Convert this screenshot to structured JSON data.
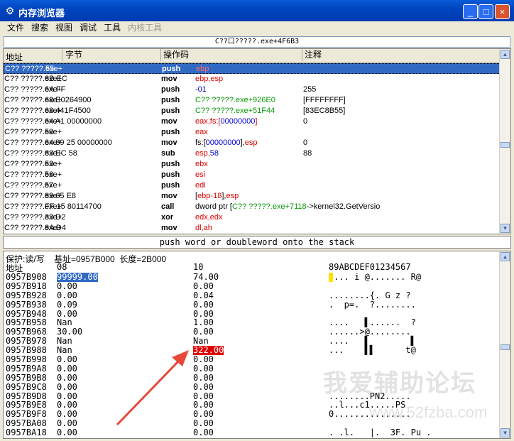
{
  "window": {
    "title": "内存浏览器",
    "buttons": [
      "_",
      "□",
      "×"
    ]
  },
  "menu": [
    {
      "label": "文件",
      "enabled": true
    },
    {
      "label": "搜索",
      "enabled": true
    },
    {
      "label": "视图",
      "enabled": true
    },
    {
      "label": "调试",
      "enabled": true
    },
    {
      "label": "工具",
      "enabled": true
    },
    {
      "label": "内核工具",
      "enabled": false
    }
  ],
  "address_bar": "C??口?????.exe+4F6B3",
  "disasm": {
    "headers": [
      "地址",
      "字节",
      "操作码",
      "注释"
    ],
    "rows": [
      {
        "addr": "C?? ?????.exe+",
        "bytes": "55",
        "op": "push",
        "args": [
          {
            "t": "ebp",
            "c": "red"
          }
        ],
        "comment": "",
        "selected": true
      },
      {
        "addr": "C?? ?????.exe+",
        "bytes": "8B EC",
        "op": "mov",
        "args": [
          {
            "t": "ebp,esp",
            "c": "red"
          }
        ],
        "comment": ""
      },
      {
        "addr": "C?? ?????.exe+",
        "bytes": "6A FF",
        "op": "push",
        "args": [
          {
            "t": "-01",
            "c": "blue"
          }
        ],
        "comment": "255"
      },
      {
        "addr": "C?? ?????.exe+",
        "bytes": "68 E0264900",
        "op": "push",
        "args": [
          {
            "t": "C?? ?????.exe+926E0",
            "c": "green"
          }
        ],
        "comment": "[FFFFFFFF]"
      },
      {
        "addr": "C?? ?????.exe+",
        "bytes": "68 441F4500",
        "op": "push",
        "args": [
          {
            "t": "C?? ?????.exe+51F44",
            "c": "green"
          }
        ],
        "comment": "[83EC8B55]"
      },
      {
        "addr": "C?? ?????.exe+",
        "bytes": "64 A1 00000000",
        "op": "mov",
        "args": [
          {
            "t": "eax,fs:[",
            "c": "red"
          },
          {
            "t": "00000000",
            "c": "blue"
          },
          {
            "t": "]",
            "c": "red"
          }
        ],
        "comment": "0"
      },
      {
        "addr": "C?? ?????.exe+",
        "bytes": "50",
        "op": "push",
        "args": [
          {
            "t": "eax",
            "c": "red"
          }
        ],
        "comment": ""
      },
      {
        "addr": "C?? ?????.exe+",
        "bytes": "64 89 25 00000000",
        "op": "mov",
        "args": [
          {
            "t": "fs:[",
            "c": "black"
          },
          {
            "t": "00000000",
            "c": "blue"
          },
          {
            "t": "],",
            "c": "black"
          },
          {
            "t": "esp",
            "c": "red"
          }
        ],
        "comment": "0"
      },
      {
        "addr": "C?? ?????.exe+",
        "bytes": "83 EC 58",
        "op": "sub",
        "args": [
          {
            "t": "esp,",
            "c": "red"
          },
          {
            "t": "58",
            "c": "blue"
          }
        ],
        "comment": "88"
      },
      {
        "addr": "C?? ?????.exe+",
        "bytes": "53",
        "op": "push",
        "args": [
          {
            "t": "ebx",
            "c": "red"
          }
        ],
        "comment": ""
      },
      {
        "addr": "C?? ?????.exe+",
        "bytes": "56",
        "op": "push",
        "args": [
          {
            "t": "esi",
            "c": "red"
          }
        ],
        "comment": ""
      },
      {
        "addr": "C?? ?????.exe+",
        "bytes": "57",
        "op": "push",
        "args": [
          {
            "t": "edi",
            "c": "red"
          }
        ],
        "comment": ""
      },
      {
        "addr": "C?? ?????.exe+",
        "bytes": "89 65 E8",
        "op": "mov",
        "args": [
          {
            "t": "[",
            "c": "black"
          },
          {
            "t": "ebp-18",
            "c": "red"
          },
          {
            "t": "],",
            "c": "black"
          },
          {
            "t": "esp",
            "c": "red"
          }
        ],
        "comment": ""
      },
      {
        "addr": "C?? ?????.exe+",
        "bytes": "FF 15 80114700",
        "op": "call",
        "args": [
          {
            "t": "dword ptr [",
            "c": "black"
          },
          {
            "t": "C?? ?????.exe+7118",
            "c": "green"
          },
          {
            "t": "->kernel32.GetVersio",
            "c": "black"
          }
        ],
        "comment": ""
      },
      {
        "addr": "C?? ?????.exe+",
        "bytes": "33 D2",
        "op": "xor",
        "args": [
          {
            "t": "edx,edx",
            "c": "red"
          }
        ],
        "comment": ""
      },
      {
        "addr": "C?? ?????.exe+",
        "bytes": "8A D4",
        "op": "mov",
        "args": [
          {
            "t": "dl,ah",
            "c": "red"
          }
        ],
        "comment": ""
      }
    ]
  },
  "opcode_description": "push word or doubleword onto the stack",
  "memory": {
    "protection_line": "保护:读/写    基址=0957B000  长度=2B000",
    "headers": [
      "地址",
      "08",
      "10",
      "89ABCDEF01234567"
    ],
    "rows": [
      {
        "addr": "0957B908",
        "v1": "99999.00",
        "v2": "74.00",
        "ascii": " ... i @....... R@",
        "hl": "v1"
      },
      {
        "addr": "0957B918",
        "v1": "0.00",
        "v2": "0.00",
        "ascii": ""
      },
      {
        "addr": "0957B928",
        "v1": "0.00",
        "v2": "0.04",
        "ascii": "........{. G z ?"
      },
      {
        "addr": "0957B938",
        "v1": "0.09",
        "v2": "0.00",
        "ascii": ".  p=.  ?........"
      },
      {
        "addr": "0957B948",
        "v1": "0.00",
        "v2": "0.00",
        "ascii": ""
      },
      {
        "addr": "0957B958",
        "v1": "Nan",
        "v2": "1.00",
        "ascii": "....   ▌......  ?"
      },
      {
        "addr": "0957B968",
        "v1": "30.00",
        "v2": "0.00",
        "ascii": "......>@........"
      },
      {
        "addr": "0957B978",
        "v1": "Nan",
        "v2": "Nan",
        "ascii": "....   ▌        ▌"
      },
      {
        "addr": "0957B988",
        "v1": "Nan",
        "v2": "322.00",
        "ascii": "...    ▌▌      t@",
        "hl": "v2"
      },
      {
        "addr": "0957B998",
        "v1": "0.00",
        "v2": "0.00",
        "ascii": ""
      },
      {
        "addr": "0957B9A8",
        "v1": "0.00",
        "v2": "0.00",
        "ascii": ""
      },
      {
        "addr": "0957B9B8",
        "v1": "0.00",
        "v2": "0.00",
        "ascii": ""
      },
      {
        "addr": "0957B9C8",
        "v1": "0.00",
        "v2": "0.00",
        "ascii": ""
      },
      {
        "addr": "0957B9D8",
        "v1": "0.00",
        "v2": "0.00",
        "ascii": "........PN2....."
      },
      {
        "addr": "0957B9E8",
        "v1": "0.00",
        "v2": "0.00",
        "ascii": "..l...c1.....PS"
      },
      {
        "addr": "0957B9F8",
        "v1": "0.00",
        "v2": "0.00",
        "ascii": "0..............."
      },
      {
        "addr": "0957BA08",
        "v1": "0.00",
        "v2": "0.00",
        "ascii": ""
      },
      {
        "addr": "0957BA18",
        "v1": "0.00",
        "v2": "0.00",
        "ascii": ". .l.   |.  3F. Pu ."
      }
    ]
  },
  "watermark": {
    "line1": "我爱辅助论坛",
    "line2": "www.52fzba.com"
  },
  "colors": {
    "title_bar": "#0045c0",
    "selection": "#316ac5",
    "register": "#e00000",
    "address": "#0a9a0a",
    "constant": "#0000d0",
    "highlight_value": "#e00000",
    "annotation_arrow": "#e8473a"
  }
}
